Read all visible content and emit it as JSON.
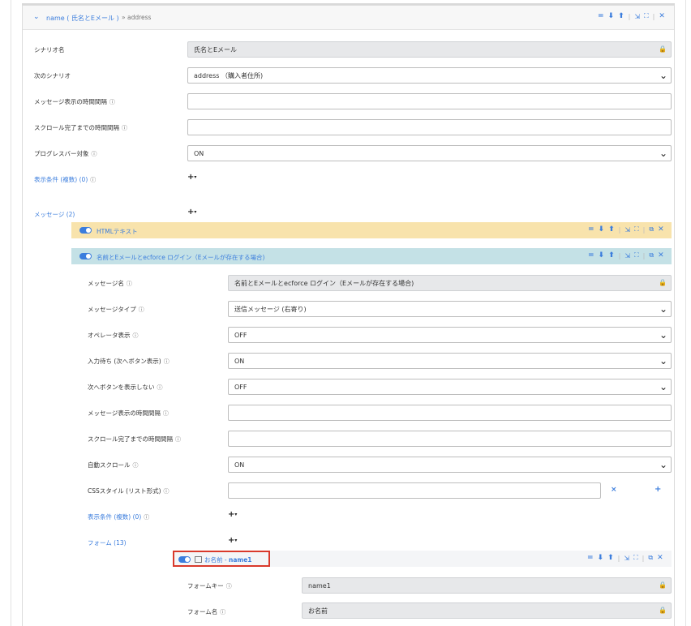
{
  "header": {
    "title": "name ( 氏名とEメール )",
    "subtitle": "» address"
  },
  "controls": {
    "eq": "=",
    "down": "⬇",
    "up": "⬆",
    "sep": "|",
    "shrink": "⇲",
    "expand": "⛶",
    "copy": "⧉",
    "close": "✕"
  },
  "scenario": {
    "name_label": "シナリオ名",
    "name_value": "氏名とEメール",
    "next_label": "次のシナリオ",
    "next_value": "address （購入者住所)",
    "interval_label": "メッセージ表示の時間間隔",
    "scroll_interval_label": "スクロール完了までの時間間隔",
    "progress_label": "プログレスバー対象",
    "progress_value": "ON",
    "conditions_label": "表示条件 (複数) (0)",
    "messages_label": "メッセージ (2)"
  },
  "messages": [
    {
      "title": "HTMLテキスト"
    },
    {
      "title": "名前とEメールとecforce ログイン（Eメールが存在する場合)"
    }
  ],
  "message_form": {
    "name_label": "メッセージ名",
    "name_value": "名前とEメールとecforce ログイン（Eメールが存在する場合)",
    "type_label": "メッセージタイプ",
    "type_value": "送信メッセージ (右寄り)",
    "operator_label": "オペレータ表示",
    "operator_value": "OFF",
    "wait_label": "入力待ち (次へボタン表示)",
    "wait_value": "ON",
    "hide_next_label": "次へボタンを表示しない",
    "hide_next_value": "OFF",
    "interval_label": "メッセージ表示の時間間隔",
    "scroll_interval_label": "スクロール完了までの時間間隔",
    "auto_scroll_label": "自動スクロール",
    "auto_scroll_value": "ON",
    "css_label": "CSSスタイル (リスト形式)",
    "css_remove": "×",
    "css_add": "+",
    "conditions_label": "表示条件 (複数) (0)",
    "forms_label": "フォーム (13)"
  },
  "form_item": {
    "title_prefix": "お名前 - ",
    "title_key": "name1",
    "key_label": "フォームキー",
    "key_value": "name1",
    "name_label": "フォーム名",
    "name_value": "お名前"
  },
  "glyphs": {
    "info": "ⓘ",
    "lock": "🔒",
    "chevron": "⌄",
    "plus": "+",
    "caret": "▾",
    "collapse_chevron": "⌄"
  }
}
